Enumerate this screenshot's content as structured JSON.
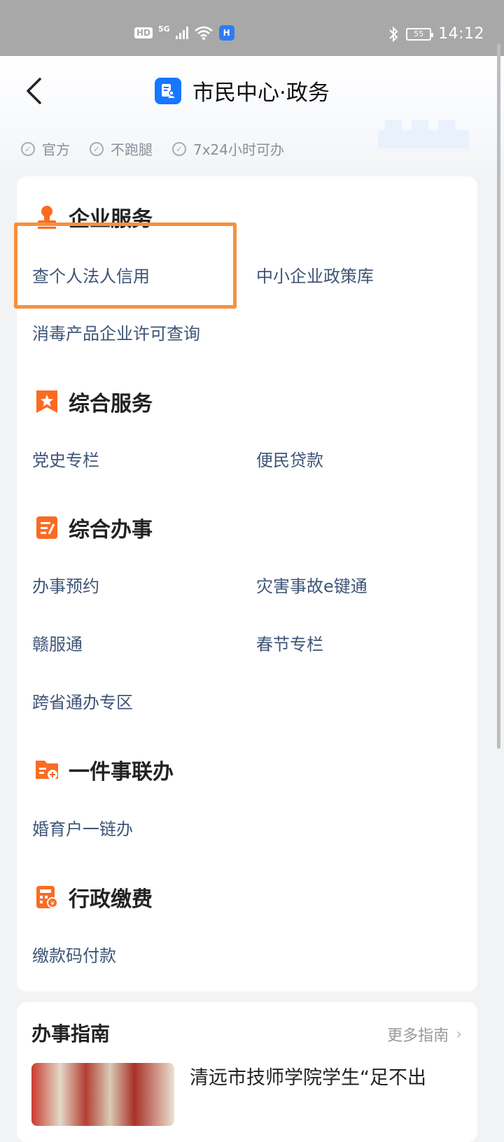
{
  "status_bar": {
    "hd": "HD",
    "network": "5G",
    "app_badge": "H",
    "battery": "55",
    "time": "14:12"
  },
  "header": {
    "back_icon": "chevron-left-icon",
    "title": "市民中心·政务"
  },
  "tags": [
    "官方",
    "不跑腿",
    "7x24小时可办"
  ],
  "sections": {
    "enterprise": {
      "title": "企业服务",
      "items": [
        "查个人法人信用",
        "中小企业政策库",
        "消毒产品企业许可查询"
      ]
    },
    "general": {
      "title": "综合服务",
      "items": [
        "党史专栏",
        "便民贷款"
      ]
    },
    "affairs": {
      "title": "综合办事",
      "items": [
        "办事预约",
        "灾害事故e键通",
        "赣服通",
        "春节专栏",
        "跨省通办专区"
      ]
    },
    "one_thing": {
      "title": "一件事联办",
      "items": [
        "婚育户一链办"
      ]
    },
    "fees": {
      "title": "行政缴费",
      "items": [
        "缴款码付款"
      ]
    }
  },
  "guide": {
    "title": "办事指南",
    "more": "更多指南",
    "article_title": "清远市技师学院学生“足不出"
  },
  "colors": {
    "accent_orange": "#f5913d",
    "icon_orange": "#fa6b22",
    "brand_blue": "#1677ff",
    "link_text": "#3e5577"
  }
}
